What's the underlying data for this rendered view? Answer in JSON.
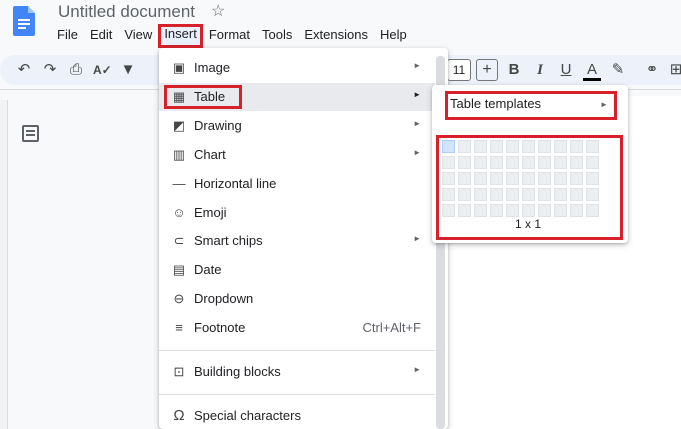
{
  "app": {
    "title": "Untitled document",
    "star_icon": "star-outline-icon",
    "logo_color": "#4285f4"
  },
  "menu": {
    "items": [
      {
        "label": "File"
      },
      {
        "label": "Edit"
      },
      {
        "label": "View"
      },
      {
        "label": "Insert"
      },
      {
        "label": "Format"
      },
      {
        "label": "Tools"
      },
      {
        "label": "Extensions"
      },
      {
        "label": "Help"
      }
    ]
  },
  "toolbar": {
    "font_size": "11",
    "icons": [
      "undo-icon",
      "redo-icon",
      "print-icon",
      "spellcheck-icon",
      "paint-format-icon",
      "increase-font-icon",
      "bold-icon",
      "italic-icon",
      "underline-icon",
      "text-color-icon",
      "highlight-icon",
      "link-icon",
      "comment-icon"
    ]
  },
  "insert_menu": {
    "items": [
      {
        "label": "Image",
        "icon": "image-icon",
        "submenu": true
      },
      {
        "label": "Table",
        "icon": "table-icon",
        "submenu": true
      },
      {
        "label": "Drawing",
        "icon": "drawing-icon",
        "submenu": true
      },
      {
        "label": "Chart",
        "icon": "chart-icon",
        "submenu": true
      },
      {
        "label": "Horizontal line",
        "icon": "horizontal-line-icon",
        "submenu": false
      },
      {
        "label": "Emoji",
        "icon": "emoji-icon",
        "submenu": false
      },
      {
        "label": "Smart chips",
        "icon": "smart-chips-icon",
        "submenu": true
      },
      {
        "label": "Date",
        "icon": "calendar-icon",
        "submenu": false
      },
      {
        "label": "Dropdown",
        "icon": "dropdown-icon",
        "submenu": false
      },
      {
        "label": "Footnote",
        "icon": "footnote-icon",
        "submenu": false,
        "shortcut": "Ctrl+Alt+F"
      },
      {
        "label": "Building blocks",
        "icon": "building-blocks-icon",
        "submenu": true
      },
      {
        "label": "Special characters",
        "icon": "omega-icon",
        "submenu": false
      }
    ]
  },
  "table_submenu": {
    "templates_label": "Table templates",
    "grid_size_label": "1 x 1",
    "grid_rows": 5,
    "grid_cols": 10,
    "selected_rows": 1,
    "selected_cols": 1
  },
  "colors": {
    "highlight_border": "#d6212b",
    "menu_active_bg": "#e8f0fe"
  }
}
